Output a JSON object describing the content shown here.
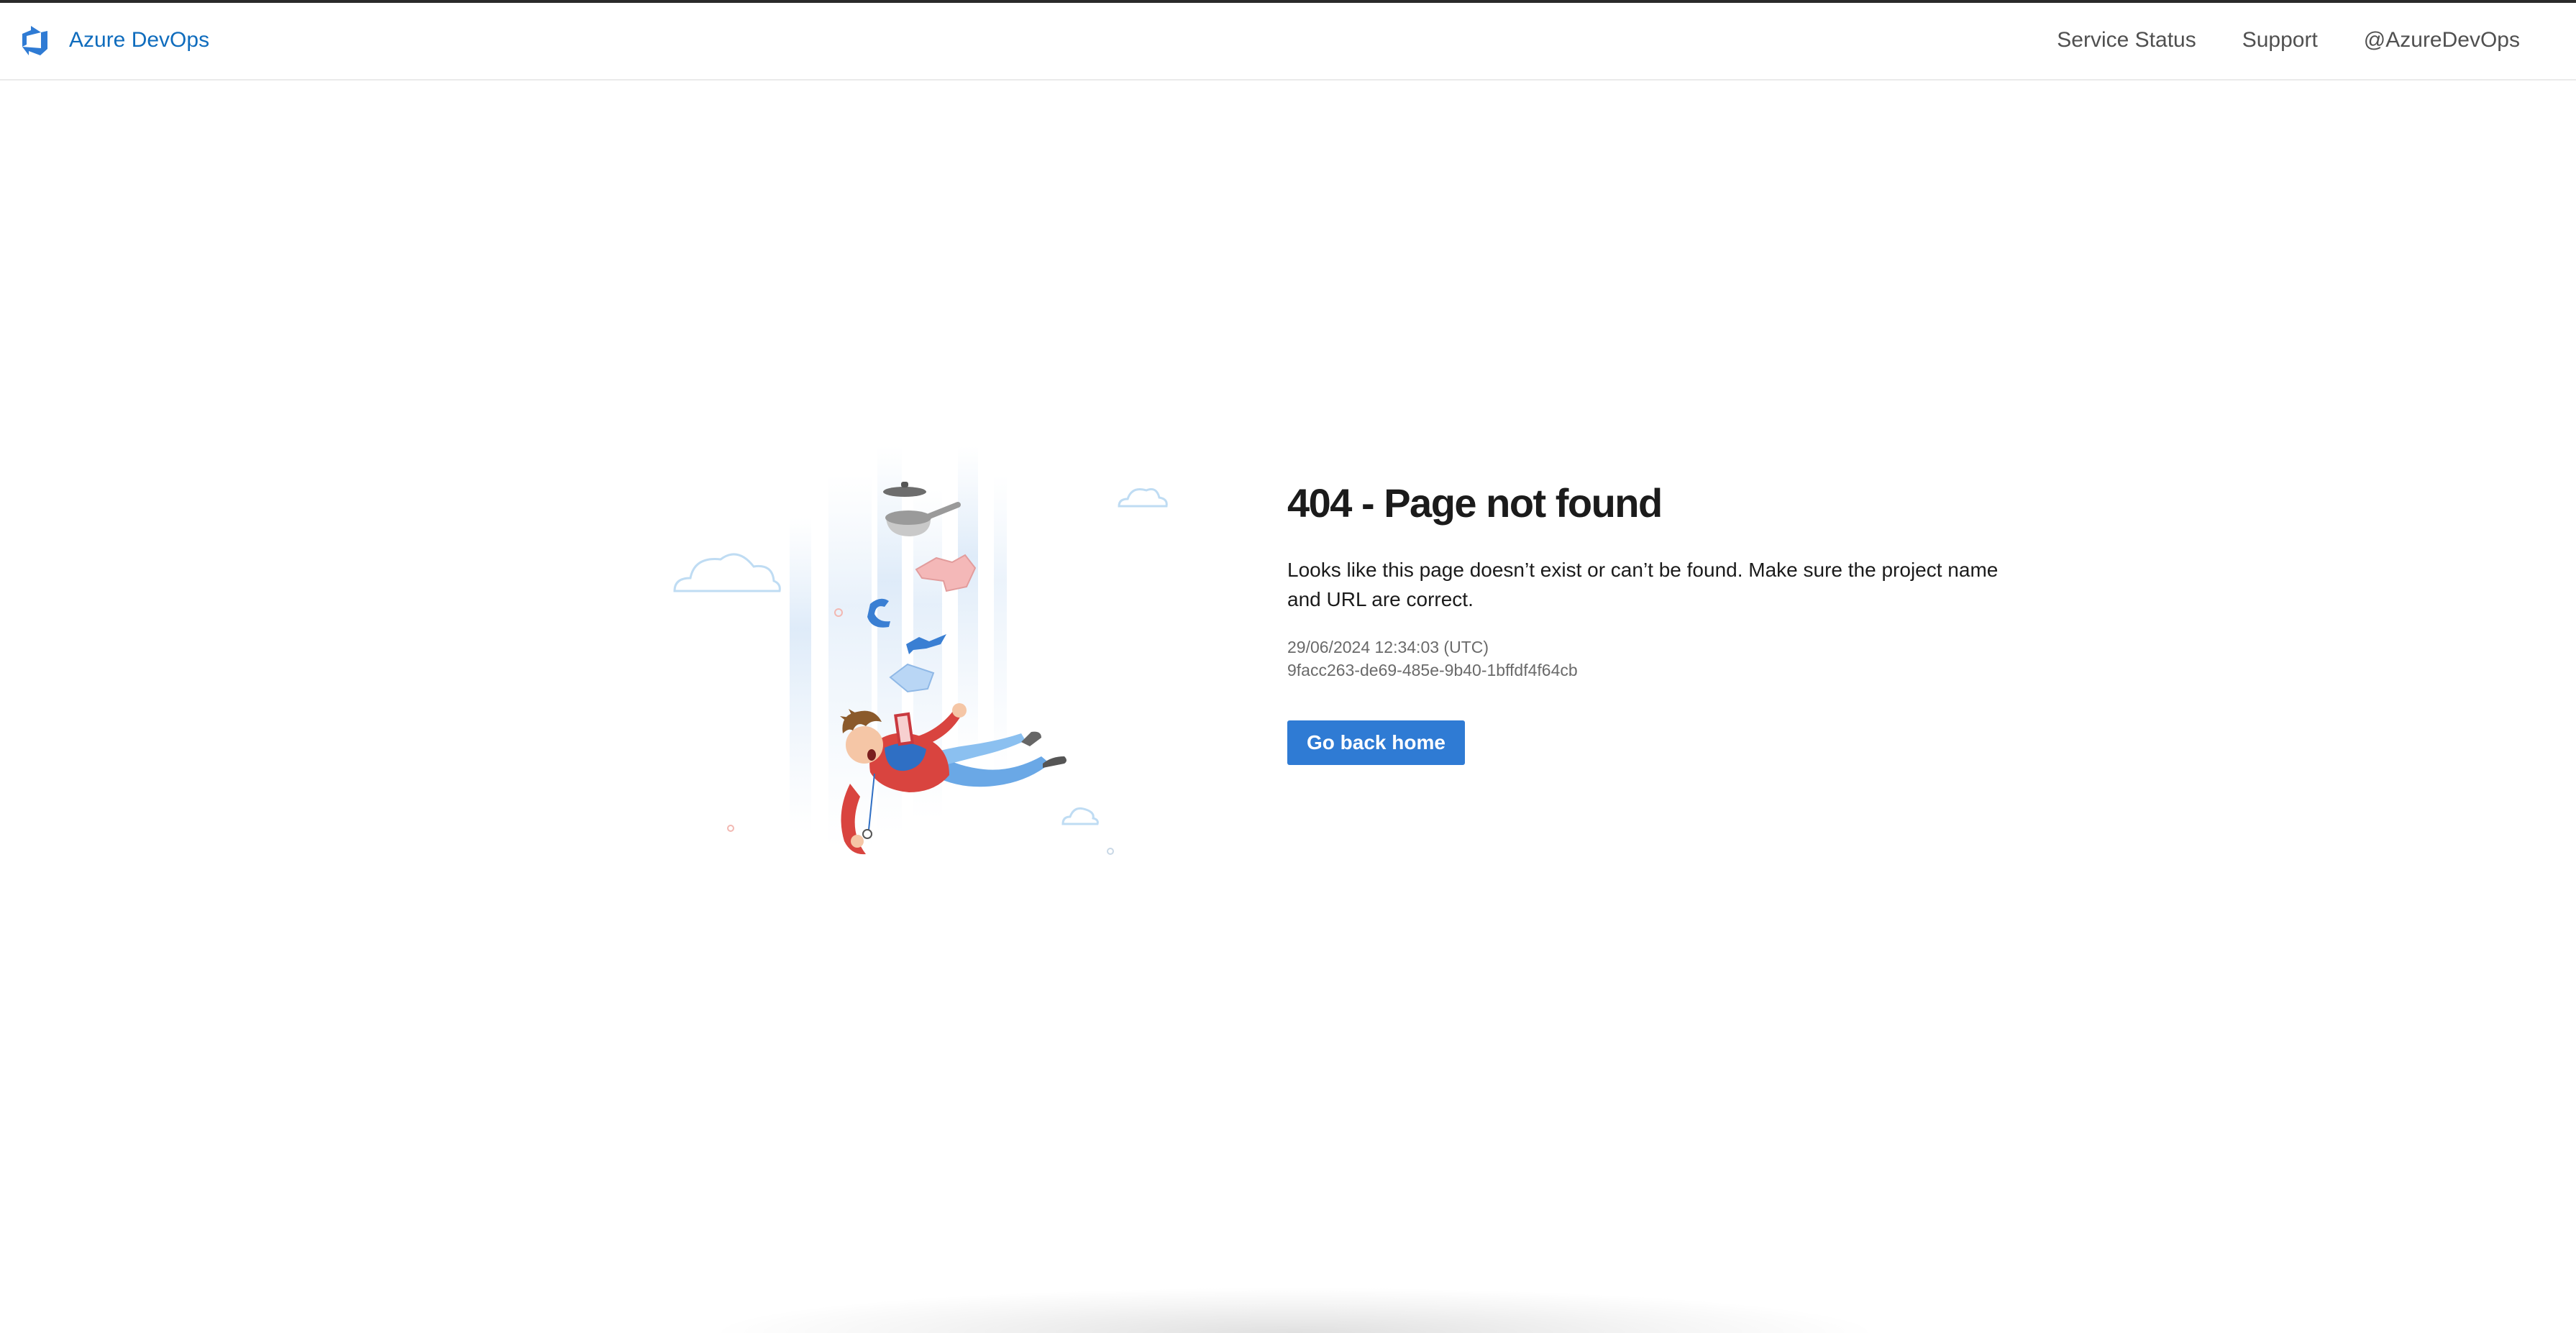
{
  "header": {
    "brand_name": "Azure DevOps",
    "brand_icon": "azure-devops-logo-icon",
    "nav": [
      {
        "label": "Service Status"
      },
      {
        "label": "Support"
      },
      {
        "label": "@AzureDevOps"
      }
    ]
  },
  "main": {
    "illustration": "falling-person-illustration",
    "title": "404 - Page not found",
    "message": "Looks like this page doesn’t exist or can’t be found. Make sure the project name and URL are correct.",
    "timestamp": "29/06/2024 12:34:03 (UTC)",
    "activity_id": "9facc263-de69-485e-9b40-1bffdf4f64cb",
    "button_label": "Go back home"
  },
  "colors": {
    "brand_blue": "#0f6cbd",
    "button_blue": "#2f7bd4",
    "title_text": "#1b1b1b",
    "nav_text": "#505050",
    "meta_text": "#6a6a6a"
  }
}
